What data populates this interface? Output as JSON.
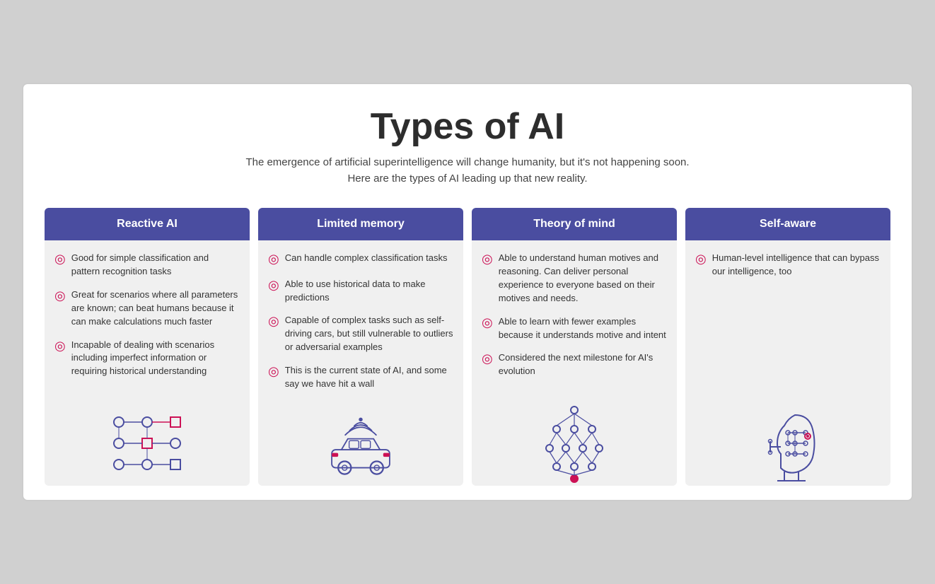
{
  "header": {
    "title": "Types of AI",
    "subtitle_line1": "The emergence of artificial superintelligence will change humanity, but it's not happening soon.",
    "subtitle_line2": "Here are the types of AI leading up that new reality."
  },
  "columns": [
    {
      "id": "reactive",
      "header": "Reactive AI",
      "bullets": [
        "Good for simple classification and pattern recognition tasks",
        "Great for scenarios where all parameters are known; can beat humans because it can make calculations much faster",
        "Incapable of dealing with scenarios including imperfect information or requiring historical understanding"
      ]
    },
    {
      "id": "limited-memory",
      "header": "Limited memory",
      "bullets": [
        "Can handle complex classification tasks",
        "Able to use historical data to make predictions",
        "Capable of complex tasks such as self-driving cars, but still vulnerable to outliers or adversarial examples",
        "This is the current state of AI, and some say we have hit a wall"
      ]
    },
    {
      "id": "theory-of-mind",
      "header": "Theory of mind",
      "bullets": [
        "Able to understand human motives and reasoning. Can deliver personal experience to everyone based on their motives and needs.",
        "Able to learn with fewer examples because it understands motive and intent",
        "Considered the next milestone for AI's evolution"
      ]
    },
    {
      "id": "self-aware",
      "header": "Self-aware",
      "bullets": [
        "Human-level intelligence that can bypass our intelligence, too"
      ]
    }
  ]
}
